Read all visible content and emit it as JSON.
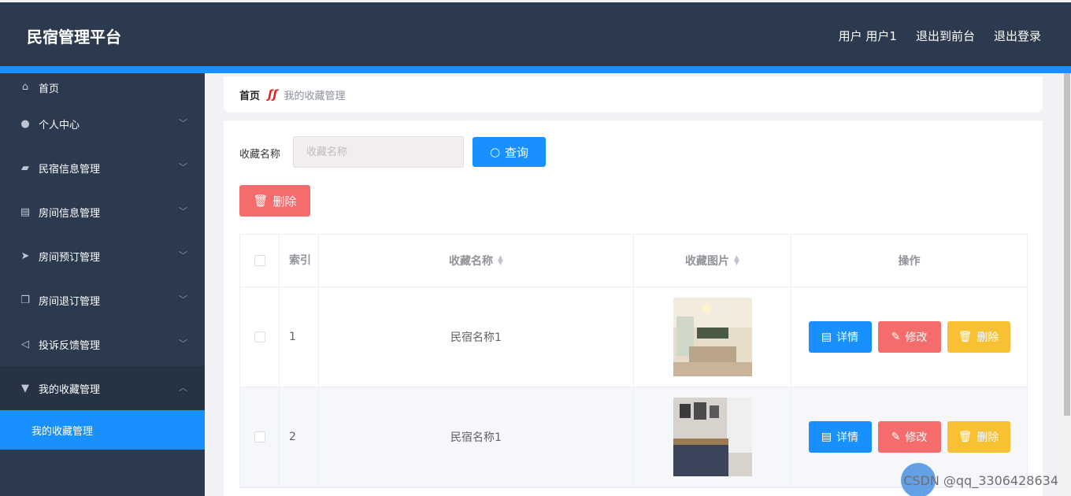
{
  "header": {
    "brand": "民宿管理平台",
    "user": "用户 用户1",
    "to_front": "退出到前台",
    "logout": "退出登录"
  },
  "sidebar": {
    "items": [
      {
        "label": "首页",
        "icon": "home-icon"
      },
      {
        "label": "个人中心",
        "icon": "user-icon"
      },
      {
        "label": "民宿信息管理",
        "icon": "wallet-icon"
      },
      {
        "label": "房间信息管理",
        "icon": "clipboard-icon"
      },
      {
        "label": "房间预订管理",
        "icon": "send-icon"
      },
      {
        "label": "房间退订管理",
        "icon": "copy-icon"
      },
      {
        "label": "投诉反馈管理",
        "icon": "navigation-icon"
      },
      {
        "label": "我的收藏管理",
        "icon": "cup-icon"
      }
    ],
    "sub_item": "我的收藏管理"
  },
  "breadcrumb": {
    "home": "首页",
    "current": "我的收藏管理"
  },
  "search": {
    "label": "收藏名称",
    "placeholder": "收藏名称",
    "button": "查询"
  },
  "toolbar": {
    "delete": "删除"
  },
  "table": {
    "headers": {
      "index": "索引",
      "name": "收藏名称",
      "image": "收藏图片",
      "actions": "操作"
    },
    "rows": [
      {
        "index": "1",
        "name": "民宿名称1"
      },
      {
        "index": "2",
        "name": "民宿名称1"
      }
    ],
    "actions": {
      "detail": "详情",
      "edit": "修改",
      "delete": "删除"
    }
  },
  "watermark": "CSDN @qq_3306428634",
  "colors": {
    "primary": "#1890ff",
    "danger": "#f56c6c",
    "warning": "#f7c133",
    "nav_bg": "#2b3a4f"
  }
}
